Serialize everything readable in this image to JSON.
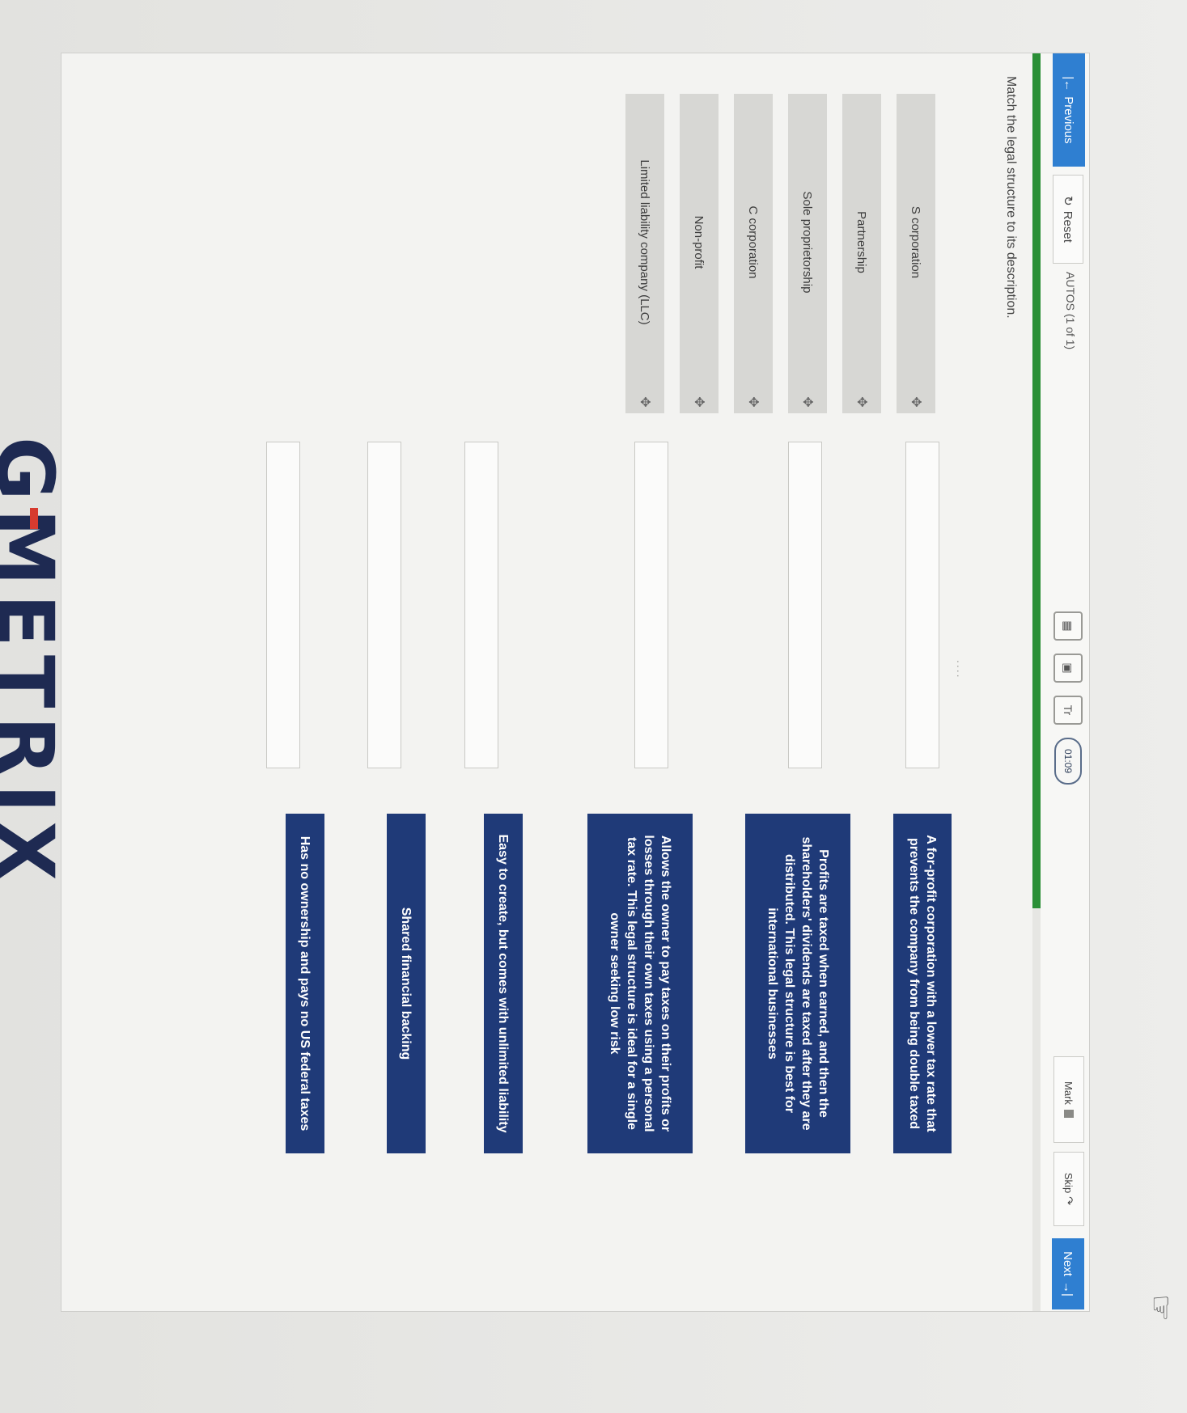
{
  "toolbar": {
    "previous_label": "Previous",
    "reset_label": "Reset",
    "attempts_text": "AUTOS (1 of 1)",
    "timer_text": "01:09",
    "font_icon_text": "Tr",
    "mark_label": "Mark",
    "skip_label": "Skip",
    "next_label": "Next"
  },
  "progress": {
    "fraction": 0.68
  },
  "question": "Match the legal structure to its description.",
  "drag_dots": "....",
  "items": [
    {
      "label": "S corporation"
    },
    {
      "label": "Partnership"
    },
    {
      "label": "Sole proprietorship"
    },
    {
      "label": "C corporation"
    },
    {
      "label": "Non-profit"
    },
    {
      "label": "Limited liability company (LLC)"
    }
  ],
  "descriptions": [
    {
      "text": "A for-profit corporation with a lower tax rate that prevents the company from being double taxed"
    },
    {
      "text": "Profits are taxed when earned, and then the shareholders' dividends are taxed after they are distributed. This legal structure is best for international businesses"
    },
    {
      "text": "Allows the owner to pay taxes on their profits or losses through their own taxes using a personal tax rate. This legal structure is ideal for a single owner seeking low risk"
    },
    {
      "text": "Easy to create, but comes with unlimited liability"
    },
    {
      "text": "Shared financial backing"
    },
    {
      "text": "Has no ownership and pays no US federal taxes"
    }
  ],
  "brand": "GMETRIX",
  "colors": {
    "accent_blue": "#2f7fd1",
    "description_navy": "#1f3a78",
    "progress_green": "#2a8f36"
  },
  "icons": [
    "previous-arrow-icon",
    "reset-icon",
    "calculator-icon",
    "bookmark-icon",
    "font-size-icon",
    "timer-icon",
    "flag-icon",
    "skip-icon",
    "next-arrow-icon",
    "hand-pointer-icon",
    "drag-handle-icon"
  ]
}
